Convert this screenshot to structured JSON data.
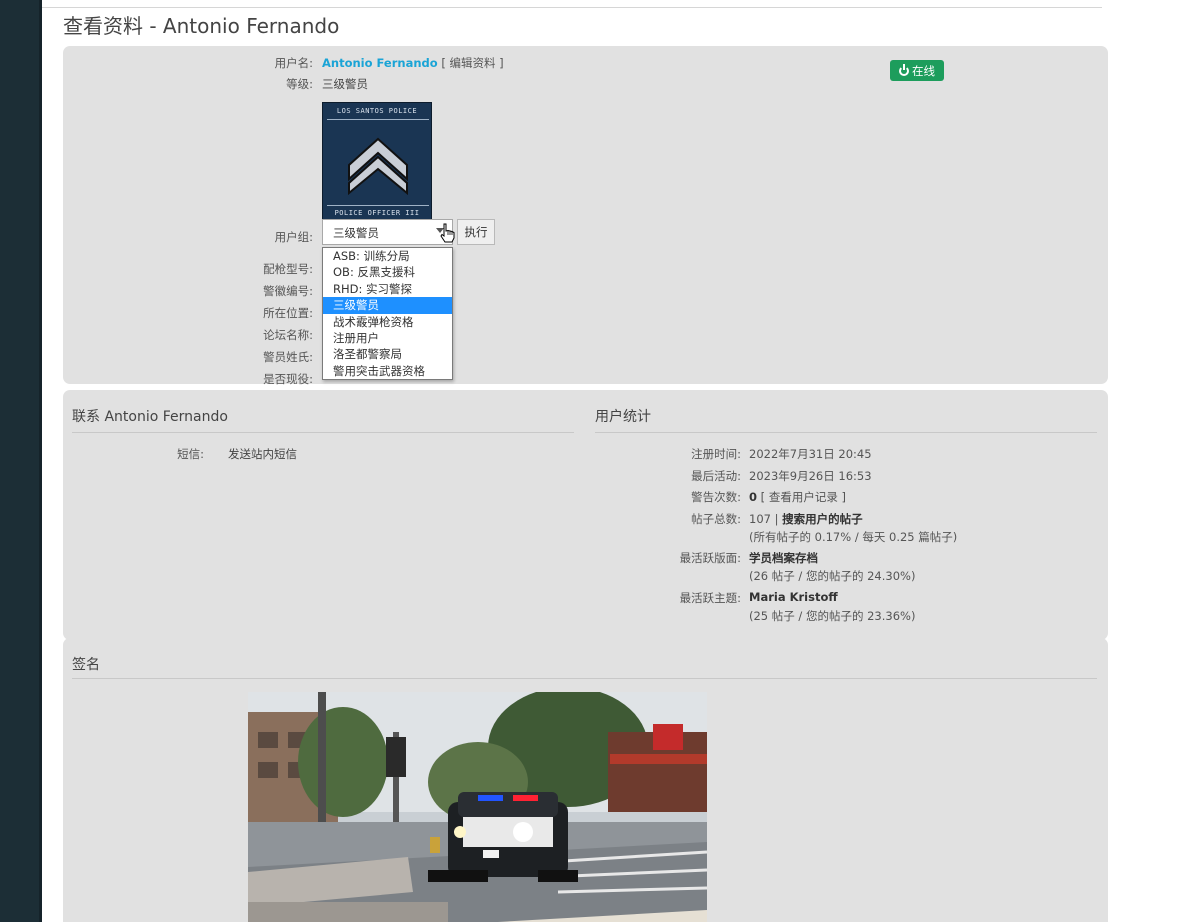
{
  "page": {
    "title": "查看资料 - Antonio Fernando"
  },
  "profile": {
    "username_label": "用户名:",
    "username": "Antonio Fernando",
    "edit_link": "[ 编辑资料 ]",
    "online_label": "在线",
    "rank_label": "等级:",
    "rank": "三级警员",
    "rank_image": {
      "top_text": "LOS SANTOS POLICE",
      "bottom_text": "POLICE OFFICER III"
    },
    "usergroup_label": "用户组:",
    "usergroup_selected": "三级警员",
    "execute_button": "执行",
    "usergroup_options": [
      "ASB: 训练分局",
      "OB: 反黑支援科",
      "RHD: 实习警探",
      "三级警员",
      "战术霰弹枪资格",
      "注册用户",
      "洛圣都警察局",
      "警用突击武器资格"
    ],
    "field_labels": [
      "配枪型号:",
      "警徽编号:",
      "所在位置:",
      "论坛名称:",
      "警员姓氏:",
      "是否现役:"
    ]
  },
  "contact": {
    "title": "联系 Antonio Fernando",
    "pm_label": "短信:",
    "pm_link": "发送站内短信"
  },
  "stats": {
    "title": "用户统计",
    "rows": [
      {
        "label": "注册时间:",
        "value": "2022年7月31日 20:45"
      },
      {
        "label": "最后活动:",
        "value": "2023年9月26日 16:53"
      },
      {
        "label": "警告次数:",
        "value_bold": "0",
        "value": " [ 查看用户记录 ]"
      },
      {
        "label": "帖子总数:",
        "value": "107 | ",
        "value_bold": "搜索用户的帖子",
        "sub": "(所有帖子的 0.17% / 每天 0.25 篇帖子)"
      },
      {
        "label": "最活跃版面:",
        "value_bold": "学员档案存档",
        "sub": "(26 帖子 / 您的帖子的 24.30%)"
      },
      {
        "label": "最活跃主题:",
        "value_bold": "Maria Kristoff",
        "sub": "(25 帖子 / 您的帖子的 23.36%)"
      }
    ]
  },
  "signature": {
    "title": "签名"
  },
  "colors": {
    "link": "#1aa4d6",
    "online": "#1d9d5c",
    "selected_option": "#1e90ff",
    "sidebar": "#1c2e36"
  }
}
